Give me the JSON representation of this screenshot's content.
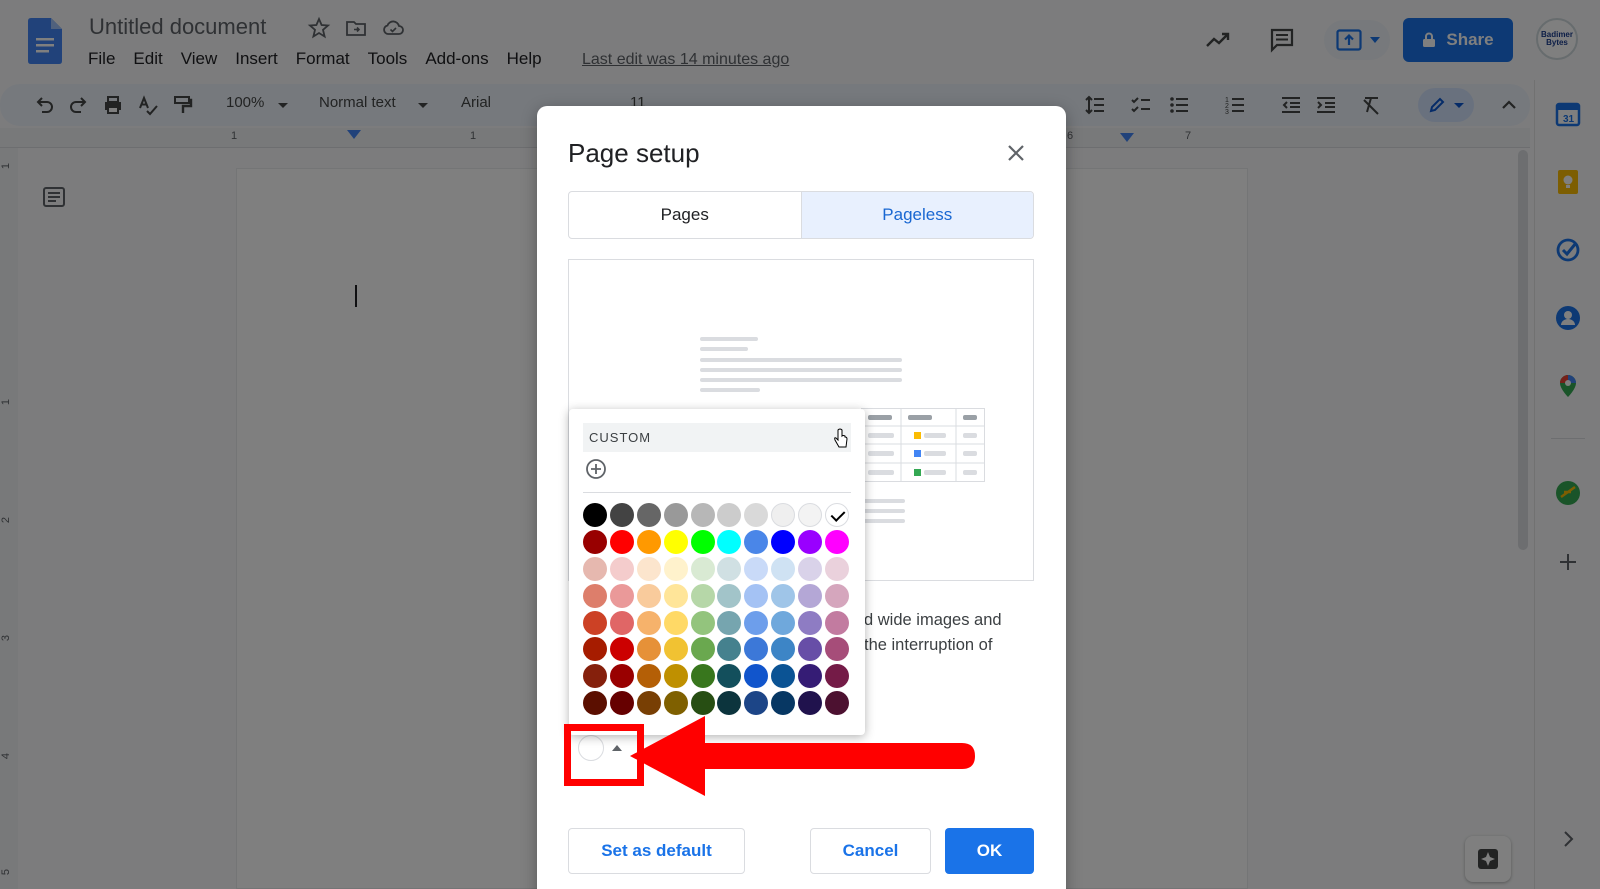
{
  "app": {
    "doc_title": "Untitled document",
    "menus": [
      "File",
      "Edit",
      "View",
      "Insert",
      "Format",
      "Tools",
      "Add-ons",
      "Help"
    ],
    "last_edit": "Last edit was 14 minutes ago",
    "share_label": "Share",
    "avatar_text": "Badimer Bytes",
    "brand_color": "#1a73e8"
  },
  "toolbar": {
    "zoom": "100%",
    "style": "Normal text",
    "font": "Arial",
    "font_size": "11"
  },
  "ruler": {
    "labels": [
      "1",
      "1",
      "6",
      "7"
    ],
    "left_labels": [
      "1",
      "1",
      "2",
      "3",
      "4",
      "5"
    ]
  },
  "dialog": {
    "title": "Page setup",
    "tabs": [
      "Pages",
      "Pageless"
    ],
    "selected_tab": "Pageless",
    "description_line1": "d wide images and",
    "description_line2": "the interruption of",
    "buttons": {
      "set_default": "Set as default",
      "cancel": "Cancel",
      "ok": "OK"
    }
  },
  "color_picker": {
    "custom_label": "CUSTOM",
    "selected": "#ffffff",
    "rows": [
      [
        "#000000",
        "#434343",
        "#666666",
        "#999999",
        "#b7b7b7",
        "#cccccc",
        "#d9d9d9",
        "#efefef",
        "#f3f3f3",
        "#ffffff"
      ],
      [
        "#980000",
        "#ff0000",
        "#ff9900",
        "#ffff00",
        "#00ff00",
        "#00ffff",
        "#4a86e8",
        "#0000ff",
        "#9900ff",
        "#ff00ff"
      ],
      [
        "#e6b8af",
        "#f4cccc",
        "#fce5cd",
        "#fff2cc",
        "#d9ead3",
        "#d0e0e3",
        "#c9daf8",
        "#cfe2f3",
        "#d9d2e9",
        "#ead1dc"
      ],
      [
        "#dd7e6b",
        "#ea9999",
        "#f9cb9c",
        "#ffe599",
        "#b6d7a8",
        "#a2c4c9",
        "#a4c2f4",
        "#9fc5e8",
        "#b4a7d6",
        "#d5a6bd"
      ],
      [
        "#cc4125",
        "#e06666",
        "#f6b26b",
        "#ffd966",
        "#93c47d",
        "#76a5af",
        "#6d9eeb",
        "#6fa8dc",
        "#8e7cc3",
        "#c27ba0"
      ],
      [
        "#a61c00",
        "#cc0000",
        "#e69138",
        "#f1c232",
        "#6aa84f",
        "#45818e",
        "#3c78d8",
        "#3d85c6",
        "#674ea7",
        "#a64d79"
      ],
      [
        "#85200c",
        "#990000",
        "#b45f06",
        "#bf9000",
        "#38761d",
        "#134f5c",
        "#1155cc",
        "#0b5394",
        "#351c75",
        "#741b47"
      ],
      [
        "#5b0f00",
        "#660000",
        "#783f04",
        "#7f6000",
        "#274e13",
        "#0c343d",
        "#1c4587",
        "#073763",
        "#20124d",
        "#4c1130"
      ]
    ]
  },
  "annotation": {
    "color": "#ff0000"
  }
}
